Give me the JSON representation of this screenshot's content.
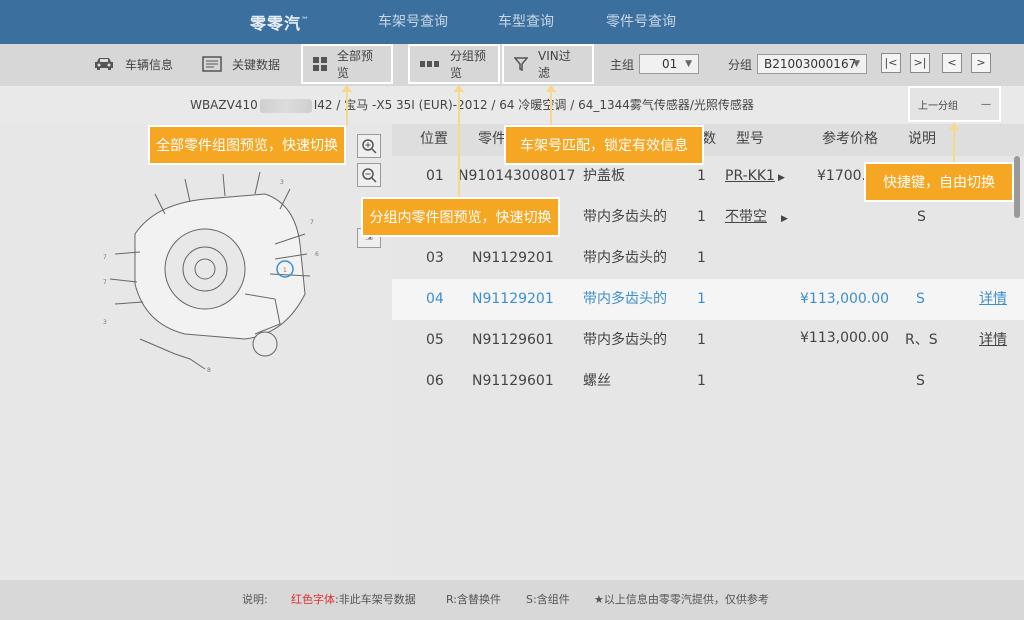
{
  "header": {
    "logo": "零零汽",
    "logo_tm": "™",
    "nav": [
      "车架号查询",
      "车型查询",
      "零件号查询"
    ]
  },
  "toolbar": {
    "vehicle_info": "车辆信息",
    "key_data": "关键数据",
    "all_preview": "全部预览",
    "group_preview": "分组预览",
    "vin_filter": "VIN过滤",
    "main_group_label": "主组",
    "main_group_value": "01",
    "sub_group_label": "分组",
    "sub_group_value": "B21003000167"
  },
  "breadcrumb": {
    "vin_start": "WBAZV410",
    "vin_end": "I42",
    "model": "宝马 -X5 35I (EUR)-2012",
    "group": "64 冷暖空调",
    "subgroup": "64_1344雾气传感器/光照传感器"
  },
  "prev_group": {
    "label": "上一分组",
    "key": "—"
  },
  "table": {
    "headers": {
      "pos": "位置",
      "part": "零件",
      "qty": "数",
      "model": "型号",
      "price": "参考价格",
      "note": "说明"
    },
    "rows": [
      {
        "pos": "01",
        "part": "N910143008017",
        "name": "护盖板",
        "qty": "1",
        "model": "PR-KK1",
        "price": "¥1700.0",
        "note": "",
        "detail": ""
      },
      {
        "pos": "02",
        "part": "",
        "name": "带内多齿头的",
        "qty": "1",
        "model": "不带空",
        "price": "",
        "note": "S",
        "detail": ""
      },
      {
        "pos": "03",
        "part": "N91129201",
        "name": "带内多齿头的",
        "qty": "1",
        "model": "",
        "price": "",
        "note": "",
        "detail": ""
      },
      {
        "pos": "04",
        "part": "N91129201",
        "name": "带内多齿头的",
        "qty": "1",
        "model": "",
        "price": "¥113,000.00",
        "note": "S",
        "detail": "详情"
      },
      {
        "pos": "05",
        "part": "N91129601",
        "name": "带内多齿头的",
        "qty": "1",
        "model": "",
        "price": "¥113,000.00",
        "note": "R、S",
        "detail": "详情"
      },
      {
        "pos": "06",
        "part": "N91129601",
        "name": "螺丝",
        "qty": "1",
        "model": "",
        "price": "",
        "note": "S",
        "detail": ""
      }
    ]
  },
  "callouts": {
    "all_preview": "全部零件组图预览，快速切换",
    "vin_match": "车架号匹配，锁定有效信息",
    "group_preview": "分组内零件图预览，快速切换",
    "shortcut": "快捷键，自由切换"
  },
  "footer": {
    "label": "说明:",
    "red_font": "红色字体",
    "red_desc": ":非此车架号数据",
    "r_desc": "R:含替换件",
    "s_desc": "S:含组件",
    "note": "★以上信息由零零汽提供，仅供参考"
  },
  "colors": {
    "header_bg": "#3a6f9e",
    "callout": "#f5a623",
    "link": "#3d8fd0",
    "red": "#e03030"
  }
}
